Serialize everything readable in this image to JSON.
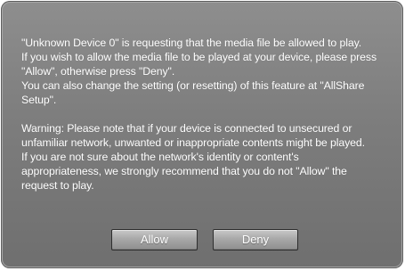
{
  "dialog": {
    "message": {
      "paragraph1": "\"Unknown Device 0\" is requesting that the media file be allowed to play.\nIf you wish to allow the media file to be played at your device, please press\n\"Allow\", otherwise press \"Deny\".\nYou can also change the setting (or resetting) of this feature at \"AllShare\nSetup\".",
      "paragraph2": "Warning: Please note that if your device is connected to unsecured or\nunfamiliar network, unwanted or inappropriate contents might be played.\nIf you are not sure about the network's identity or content's\nappropriateness, we strongly recommend that you do not \"Allow\" the\nrequest to play."
    },
    "buttons": {
      "allow_label": "Allow",
      "deny_label": "Deny"
    }
  },
  "colors": {
    "dialog_background": "#7d7d7d",
    "text": "#ffffff",
    "button_face": "#a8a8a8"
  }
}
